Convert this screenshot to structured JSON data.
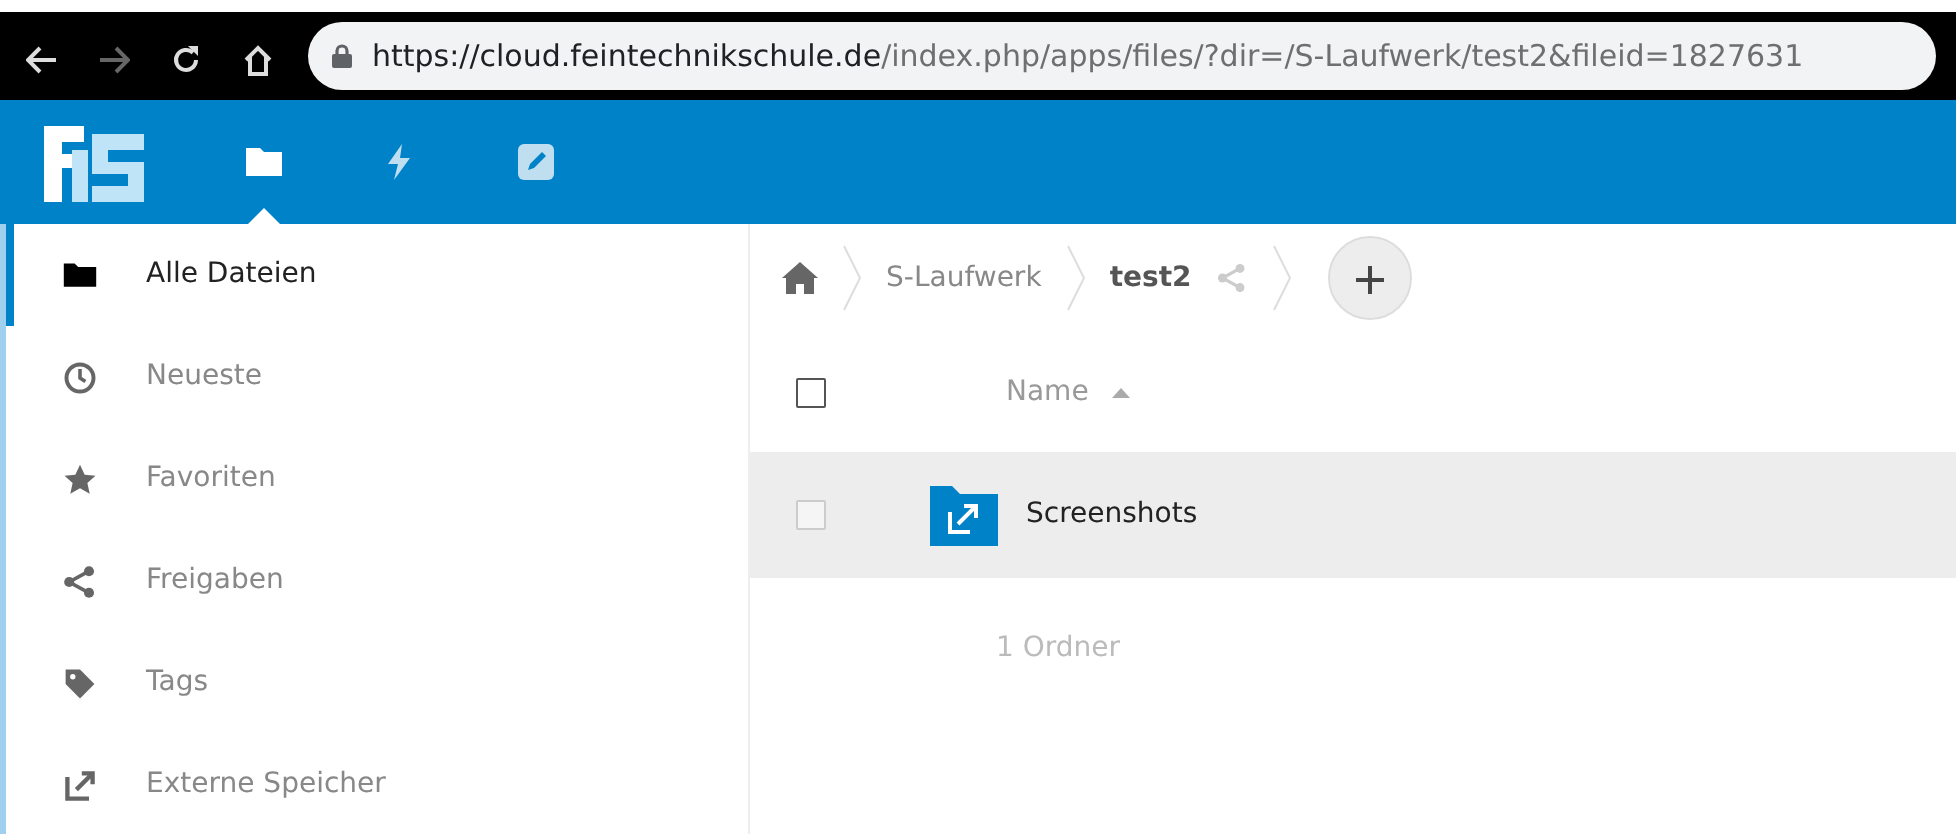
{
  "browser": {
    "url_host": "https://cloud.feintechnikschule.de",
    "url_path": "/index.php/apps/files/?dir=/S-Laufwerk/test2&fileid=1827631"
  },
  "apps": [
    {
      "kind": "files",
      "selected": true
    },
    {
      "kind": "activity",
      "selected": false
    },
    {
      "kind": "notes",
      "selected": false
    }
  ],
  "sidebar": {
    "items": [
      {
        "kind": "folder",
        "label": "Alle Dateien",
        "selected": true
      },
      {
        "kind": "clock",
        "label": "Neueste",
        "selected": false
      },
      {
        "kind": "star",
        "label": "Favoriten",
        "selected": false
      },
      {
        "kind": "share",
        "label": "Freigaben",
        "selected": false
      },
      {
        "kind": "tag",
        "label": "Tags",
        "selected": false
      },
      {
        "kind": "external",
        "label": "Externe Speicher",
        "selected": false
      }
    ]
  },
  "breadcrumbs": [
    {
      "label": "S-Laufwerk",
      "current": false,
      "shared": false
    },
    {
      "label": "test2",
      "current": true,
      "shared": true
    }
  ],
  "table": {
    "columns": [
      {
        "label": "Name",
        "sorted_ascending": true
      }
    ],
    "select_all_checked": false,
    "rows": [
      {
        "name": "Screenshots",
        "kind": "external-folder",
        "checked": false,
        "highlighted": true
      }
    ],
    "summary": "1 Ordner"
  }
}
